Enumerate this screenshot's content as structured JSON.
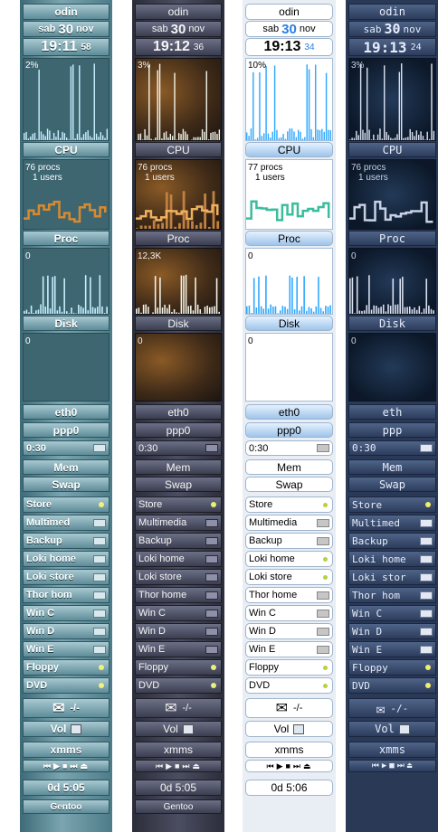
{
  "columns": [
    {
      "theme": "A",
      "host": "odin",
      "day": "sab",
      "date_num": "30",
      "month": "nov",
      "time": "19:11",
      "secs": "58",
      "cpu_pct": "2%",
      "cpu_label": "CPU",
      "procs": "76 procs",
      "users": "1 users",
      "proc_label": "Proc",
      "proc_val": "0",
      "disk_label": "Disk",
      "disk_val": "0",
      "net1": "eth0",
      "net2": "ppp0",
      "timer": "0:30",
      "mem": "Mem",
      "swap": "Swap",
      "mounts": [
        "Store",
        "Multimed",
        "Backup",
        "Loki home",
        "Loki store",
        "Thor hom",
        "Win C",
        "Win D",
        "Win E",
        "Floppy",
        "DVD"
      ],
      "mail_sep": "-/-",
      "vol": "Vol",
      "xmms": "xmms",
      "uptime": "0d 5:05",
      "footer": "Gentoo"
    },
    {
      "theme": "B",
      "host": "odin",
      "day": "sab",
      "date_num": "30",
      "month": "nov",
      "time": "19:12",
      "secs": "36",
      "cpu_pct": "3%",
      "cpu_label": "CPU",
      "procs": "76 procs",
      "users": "1 users",
      "proc_label": "Proc",
      "proc_val": "12,3K",
      "disk_label": "Disk",
      "disk_val": "0",
      "net1": "eth0",
      "net2": "ppp0",
      "timer": "0:30",
      "mem": "Mem",
      "swap": "Swap",
      "mounts": [
        "Store",
        "Multimedia",
        "Backup",
        "Loki home",
        "Loki store",
        "Thor home",
        "Win C",
        "Win D",
        "Win E",
        "Floppy",
        "DVD"
      ],
      "mail_sep": "-/-",
      "vol": "Vol",
      "xmms": "xmms",
      "uptime": "0d 5:05",
      "footer": "Gentoo"
    },
    {
      "theme": "C",
      "host": "odin",
      "day": "sab",
      "date_num": "30",
      "month": "nov",
      "time": "19:13",
      "secs": "34",
      "cpu_pct": "10%",
      "cpu_label": "CPU",
      "procs": "77 procs",
      "users": "1 users",
      "proc_label": "Proc",
      "proc_val": "0",
      "disk_label": "Disk",
      "disk_val": "0",
      "net1": "eth0",
      "net2": "ppp0",
      "timer": "0:30",
      "mem": "Mem",
      "swap": "Swap",
      "mounts": [
        "Store",
        "Multimedia",
        "Backup",
        "Loki home",
        "Loki store",
        "Thor home",
        "Win C",
        "Win D",
        "Win E",
        "Floppy",
        "DVD"
      ],
      "mail_sep": "-/-",
      "vol": "Vol",
      "xmms": "xmms",
      "uptime": "0d 5:06",
      "footer": ""
    },
    {
      "theme": "D",
      "host": "odin",
      "day": "sab",
      "date_num": "30",
      "month": "nov",
      "time": "19:13",
      "secs": "24",
      "cpu_pct": "3%",
      "cpu_label": "CPU",
      "procs": "76 procs",
      "users": "1 users",
      "proc_label": "Proc",
      "proc_val": "0",
      "disk_label": "Disk",
      "disk_val": "0",
      "net1": "eth",
      "net2": "ppp",
      "timer": "0:30",
      "mem": "Mem",
      "swap": "Swap",
      "mounts": [
        "Store",
        "Multimed",
        "Backup",
        "Loki home",
        "Loki stor",
        "Thor hom",
        "Win C",
        "Win D",
        "Win E",
        "Floppy",
        "DVD"
      ],
      "mail_sep": "-/-",
      "vol": "Vol",
      "xmms": "xmms",
      "uptime": "",
      "footer": ""
    }
  ]
}
